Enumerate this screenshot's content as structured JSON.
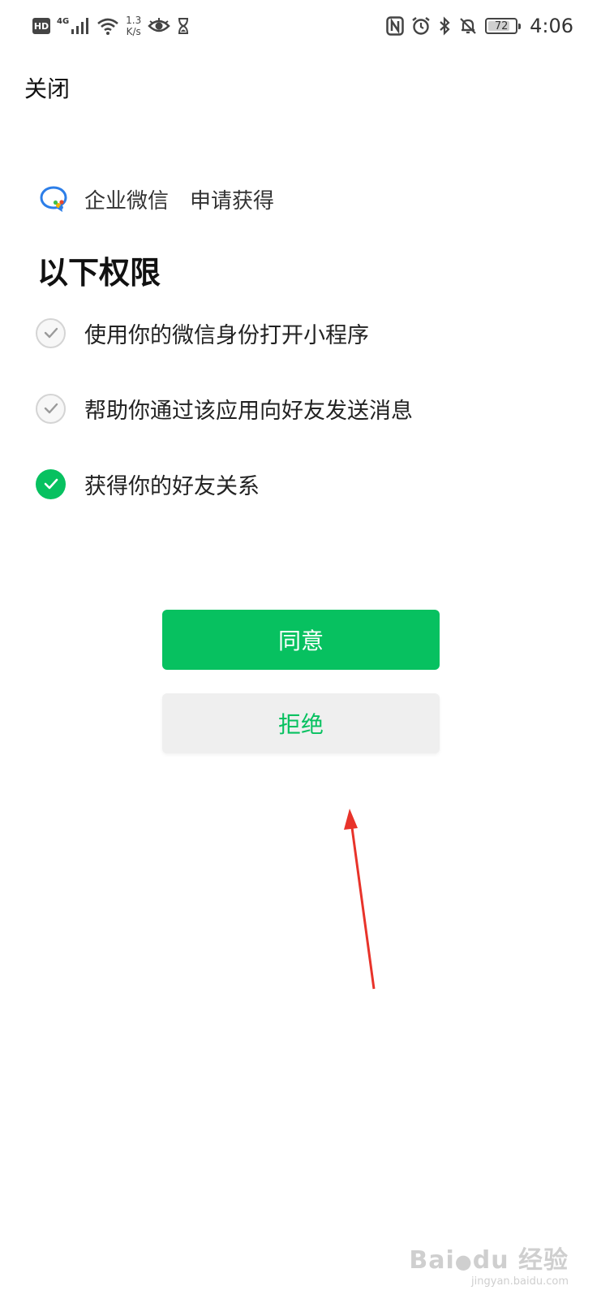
{
  "status_bar": {
    "hd": "HD",
    "network": "4G",
    "speed_value": "1.3",
    "speed_unit": "K/s",
    "battery": "72",
    "time": "4:06"
  },
  "header": {
    "close_label": "关闭"
  },
  "request": {
    "app_name": "企业微信",
    "request_text": "申请获得",
    "title": "以下权限"
  },
  "permissions": [
    {
      "label": "使用你的微信身份打开小程序",
      "checked": false
    },
    {
      "label": "帮助你通过该应用向好友发送消息",
      "checked": false
    },
    {
      "label": "获得你的好友关系",
      "checked": true
    }
  ],
  "actions": {
    "agree_label": "同意",
    "reject_label": "拒绝"
  },
  "colors": {
    "accent": "#07c160",
    "annotation_arrow": "#e8332a"
  }
}
